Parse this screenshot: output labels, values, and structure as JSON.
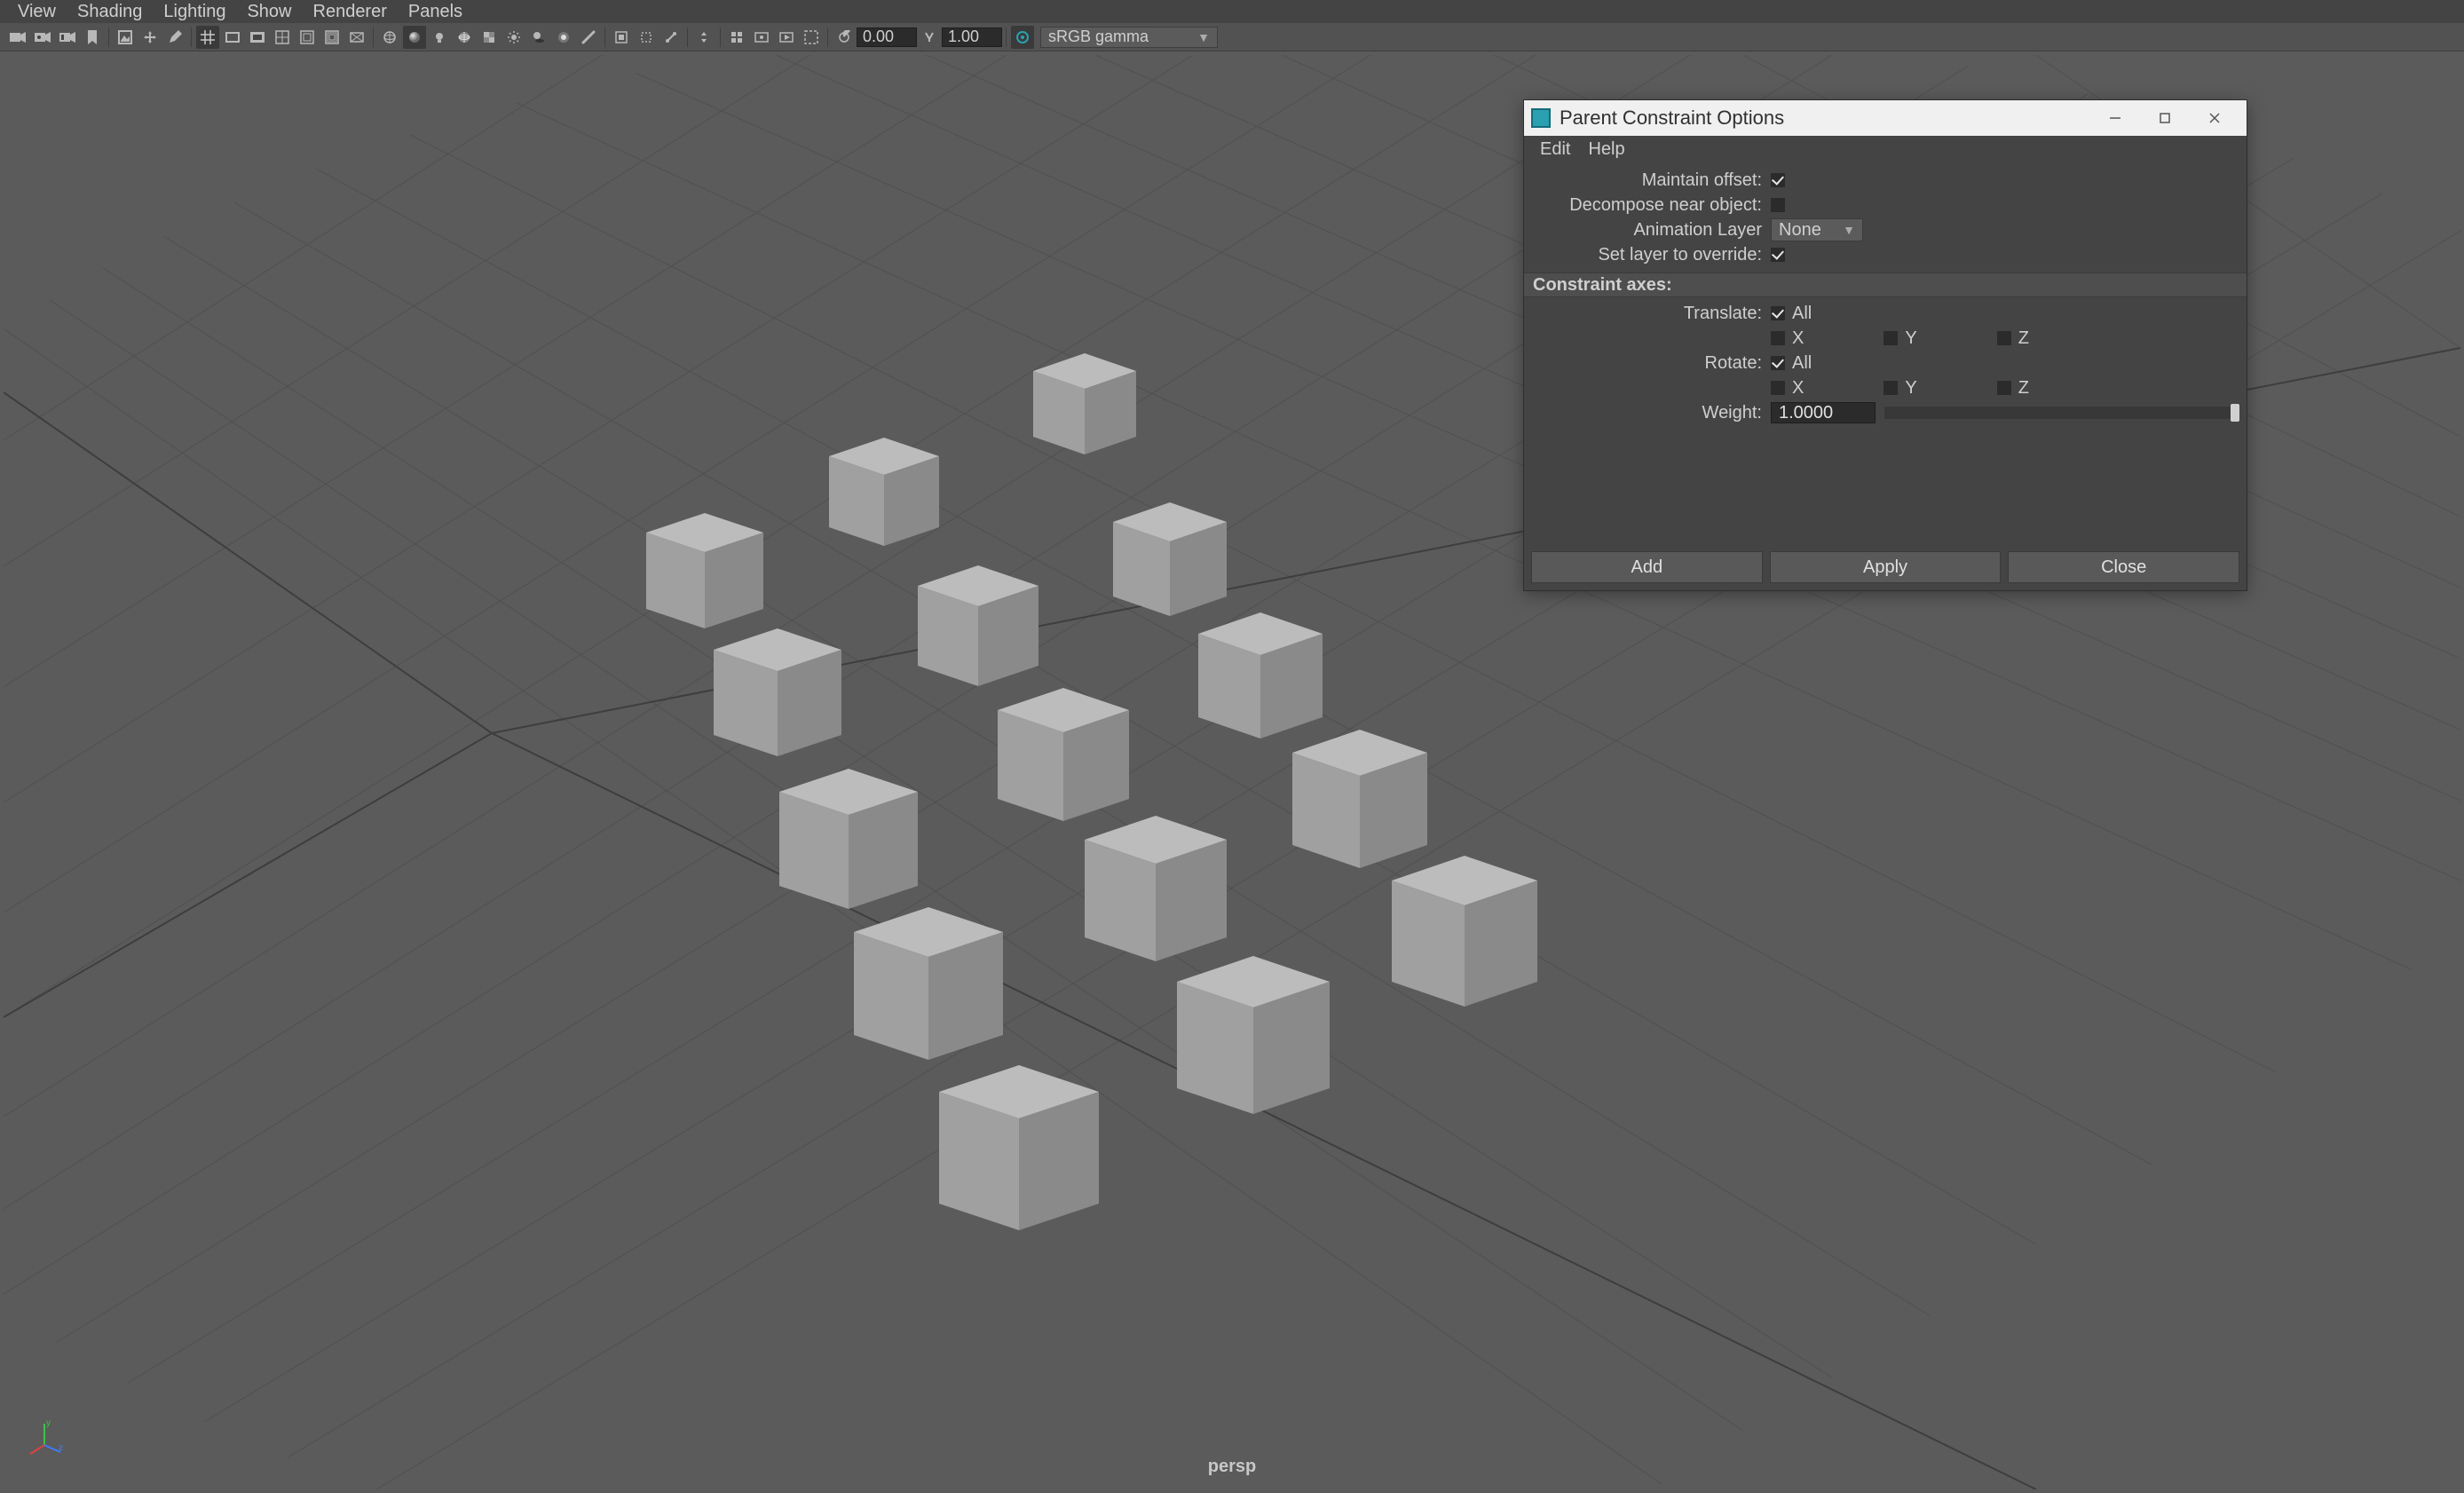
{
  "menubar": {
    "items": [
      "View",
      "Shading",
      "Lighting",
      "Show",
      "Renderer",
      "Panels"
    ]
  },
  "toolbar": {
    "exposure": "0.00",
    "gamma": "1.00",
    "colorspace": "sRGB gamma"
  },
  "viewport": {
    "camera": "persp"
  },
  "dialog": {
    "title": "Parent Constraint Options",
    "menu": [
      "Edit",
      "Help"
    ],
    "maintain_offset_label": "Maintain offset:",
    "maintain_offset": true,
    "decompose_label": "Decompose near object:",
    "decompose": false,
    "anim_layer_label": "Animation Layer",
    "anim_layer_value": "None",
    "set_override_label": "Set layer to override:",
    "set_override": true,
    "section": "Constraint axes:",
    "translate_label": "Translate:",
    "translate_all": true,
    "rotate_label": "Rotate:",
    "rotate_all": true,
    "axis_all": "All",
    "axis_x": "X",
    "axis_y": "Y",
    "axis_z": "Z",
    "weight_label": "Weight:",
    "weight_value": "1.0000",
    "buttons": {
      "add": "Add",
      "apply": "Apply",
      "close": "Close"
    }
  }
}
